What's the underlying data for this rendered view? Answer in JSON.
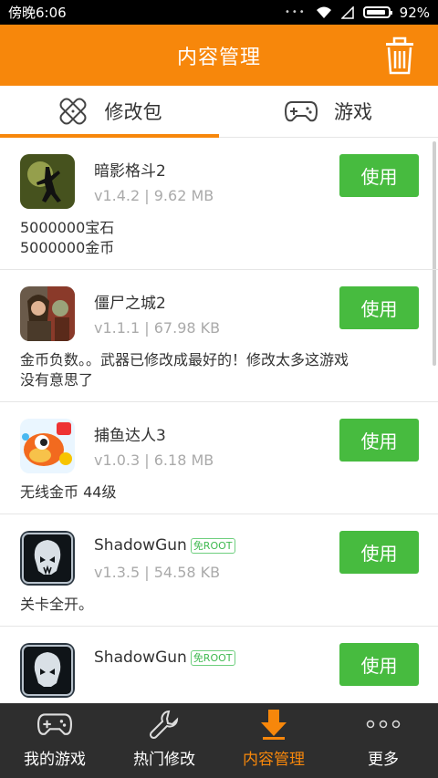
{
  "status_bar": {
    "time": "傍晚6:06",
    "battery": "92%"
  },
  "header": {
    "title": "内容管理"
  },
  "tabs": [
    {
      "label": "修改包",
      "active": true
    },
    {
      "label": "游戏",
      "active": false
    }
  ],
  "items": [
    {
      "name": "暗影格斗2",
      "badge": "",
      "meta": "v1.4.2 | 9.62 MB",
      "button": "使用",
      "desc": [
        "5000000宝石",
        "5000000金币"
      ]
    },
    {
      "name": "僵尸之城2",
      "badge": "",
      "meta": "v1.1.1 | 67.98 KB",
      "button": "使用",
      "desc": [
        "金币负数。。武器已修改成最好的！修改太多这游戏",
        "没有意思了"
      ]
    },
    {
      "name": "捕鱼达人3",
      "badge": "",
      "meta": "v1.0.3 | 6.18 MB",
      "button": "使用",
      "desc": [
        "无线金币  44级"
      ]
    },
    {
      "name": "ShadowGun",
      "badge": "免ROOT",
      "meta": "v1.3.5 | 54.58 KB",
      "button": "使用",
      "desc": [
        "关卡全开。"
      ]
    },
    {
      "name": "ShadowGun",
      "badge": "免ROOT",
      "meta": "",
      "button": "使用",
      "desc": []
    }
  ],
  "bottom_nav": [
    {
      "label": "我的游戏",
      "icon": "gamepad-icon",
      "active": false
    },
    {
      "label": "热门修改",
      "icon": "wrench-icon",
      "active": false
    },
    {
      "label": "内容管理",
      "icon": "download-arrow-icon",
      "active": true
    },
    {
      "label": "更多",
      "icon": "more-dots-icon",
      "active": false
    }
  ],
  "colors": {
    "accent": "#f7870b",
    "button_green": "#47bb3f",
    "nav_bg": "#2e2e2e"
  }
}
